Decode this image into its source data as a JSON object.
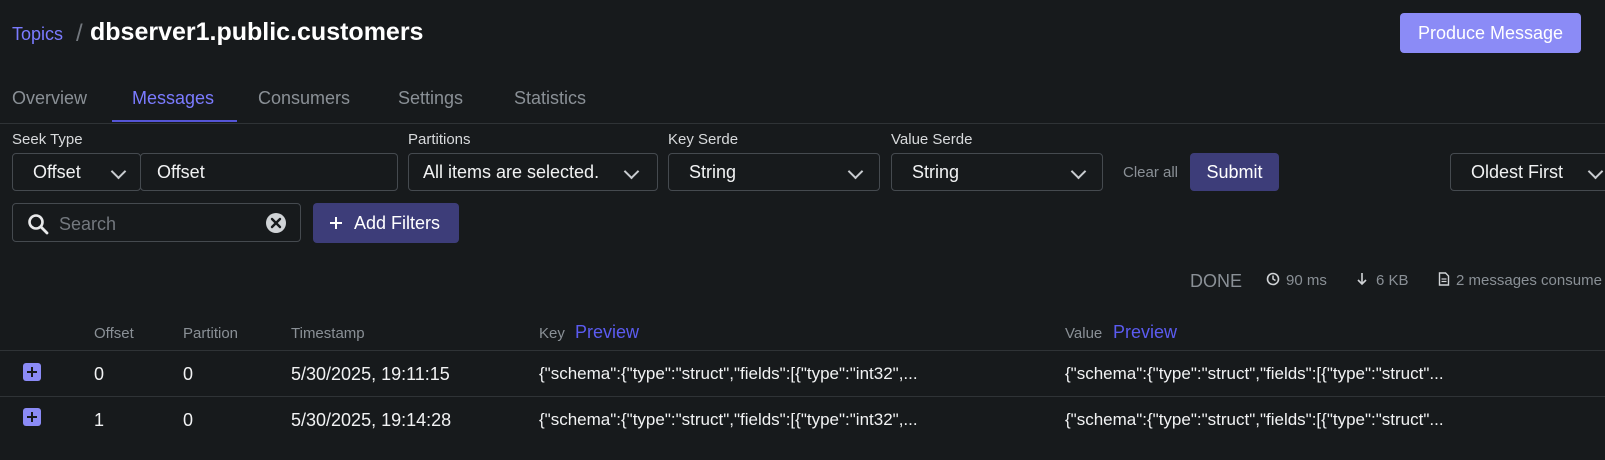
{
  "header": {
    "breadcrumb": "Topics",
    "separator": "/",
    "title": "dbserver1.public.customers",
    "produce_label": "Produce Message"
  },
  "tabs": [
    {
      "label": "Overview"
    },
    {
      "label": "Messages"
    },
    {
      "label": "Consumers"
    },
    {
      "label": "Settings"
    },
    {
      "label": "Statistics"
    }
  ],
  "active_tab": "Messages",
  "filters": {
    "seek_type": {
      "label": "Seek Type",
      "value": "Offset",
      "input_value": "Offset"
    },
    "partitions": {
      "label": "Partitions",
      "value": "All items are selected."
    },
    "key_serde": {
      "label": "Key Serde",
      "value": "String"
    },
    "value_serde": {
      "label": "Value Serde",
      "value": "String"
    },
    "clear_label": "Clear all",
    "submit_label": "Submit",
    "sort": "Oldest First",
    "search_placeholder": "Search",
    "add_filters_label": "Add Filters"
  },
  "stats": {
    "status": "DONE",
    "time": "90 ms",
    "size": "6 KB",
    "consumed": "2 messages consume"
  },
  "table": {
    "headers": {
      "offset": "Offset",
      "partition": "Partition",
      "timestamp": "Timestamp",
      "key": "Key",
      "value": "Value",
      "preview": "Preview"
    },
    "rows": [
      {
        "offset": "0",
        "partition": "0",
        "timestamp": "5/30/2025, 19:11:15",
        "key": "{\"schema\":{\"type\":\"struct\",\"fields\":[{\"type\":\"int32\",...",
        "value": "{\"schema\":{\"type\":\"struct\",\"fields\":[{\"type\":\"struct\"..."
      },
      {
        "offset": "1",
        "partition": "0",
        "timestamp": "5/30/2025, 19:14:28",
        "key": "{\"schema\":{\"type\":\"struct\",\"fields\":[{\"type\":\"int32\",...",
        "value": "{\"schema\":{\"type\":\"struct\",\"fields\":[{\"type\":\"struct\"..."
      }
    ]
  },
  "colors": {
    "accent": "#7b7bff",
    "button": "#8b8bf6",
    "dark_button": "#3d3d79",
    "background": "#171a1c"
  }
}
